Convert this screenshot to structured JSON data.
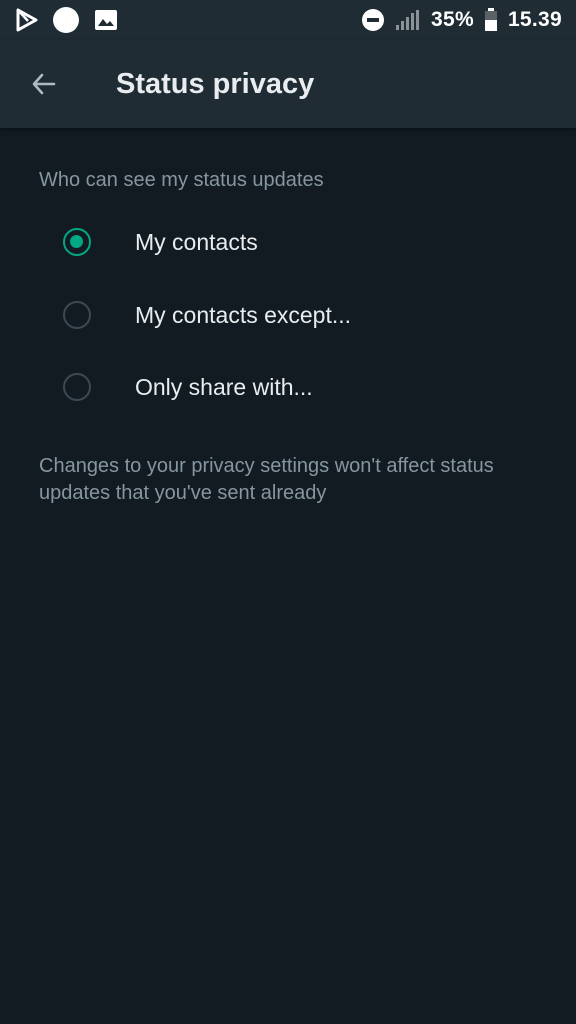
{
  "status_bar": {
    "battery_percent": "35%",
    "time": "15.39",
    "icons": [
      "play-store-icon",
      "circle-notification-icon",
      "image-icon",
      "do-not-disturb-icon",
      "signal-icon",
      "battery-icon"
    ]
  },
  "app_bar": {
    "title": "Status privacy",
    "back_icon": "arrow-left-icon"
  },
  "section": {
    "title": "Who can see my status updates"
  },
  "options": [
    {
      "label": "My contacts",
      "selected": true
    },
    {
      "label": "My contacts except...",
      "selected": false
    },
    {
      "label": "Only share with...",
      "selected": false
    }
  ],
  "note": "Changes to your privacy settings won't affect status updates that you've sent already",
  "colors": {
    "background": "#121b22",
    "app_bar": "#1f2c34",
    "accent": "#00a884",
    "primary_text": "#e9edef",
    "secondary_text": "#8696a0"
  }
}
